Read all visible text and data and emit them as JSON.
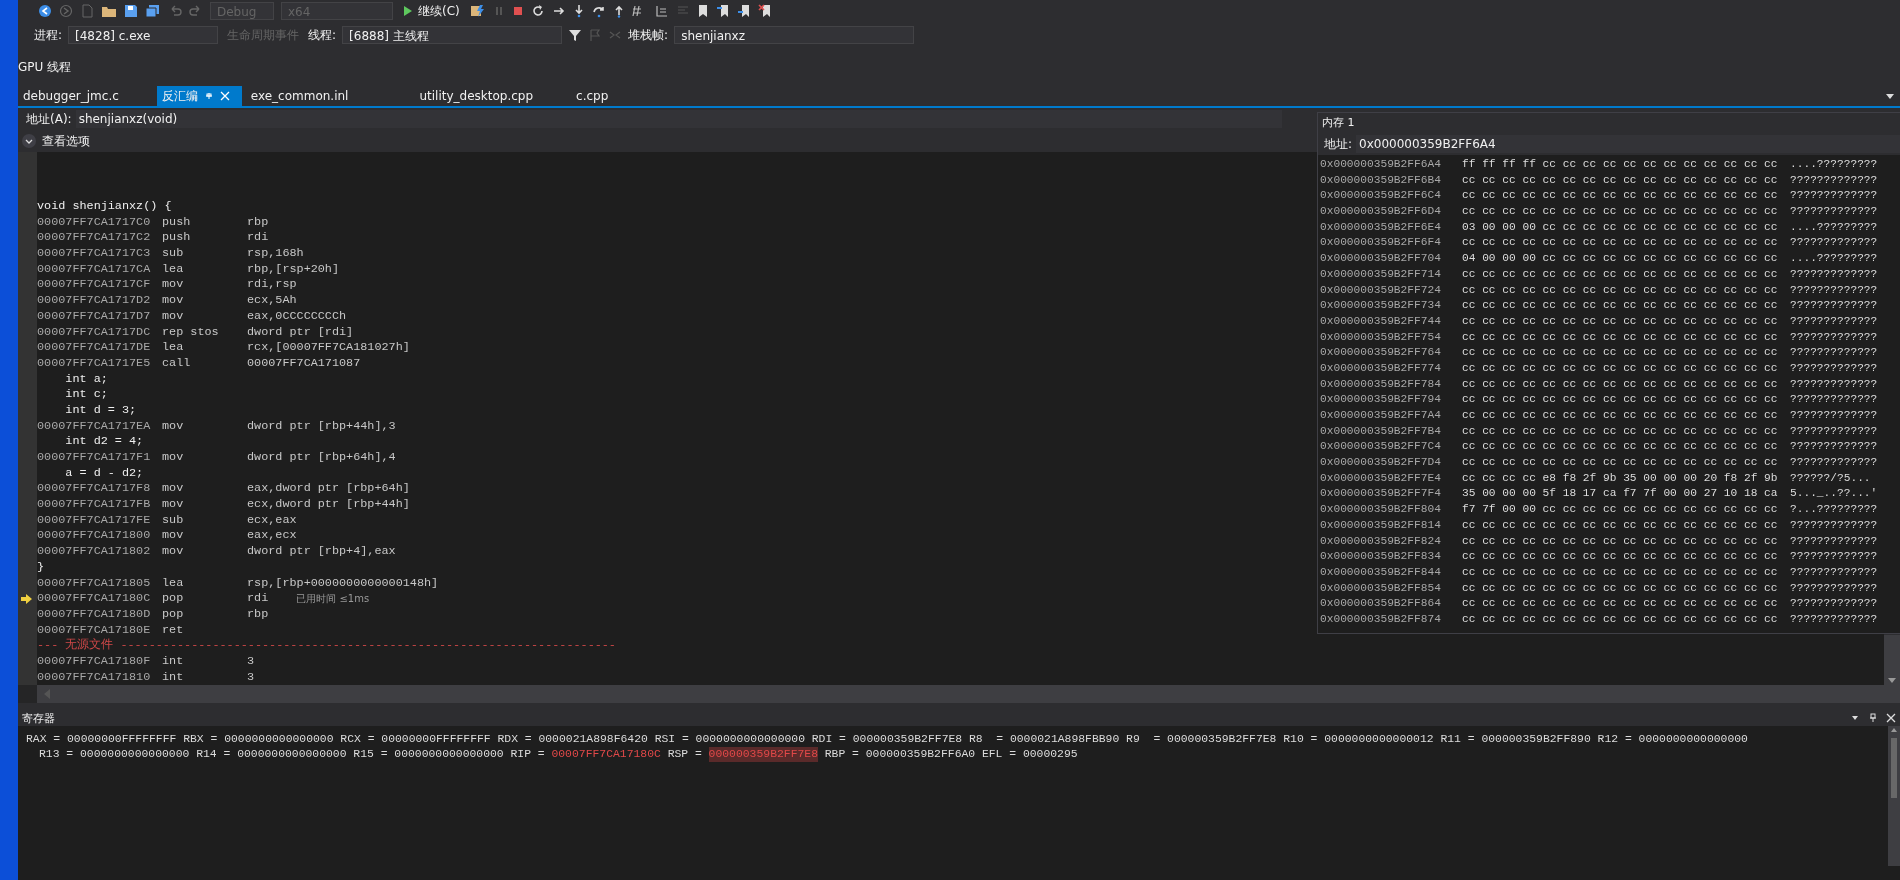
{
  "toolbar": {
    "configuration": "Debug",
    "platform": "x64",
    "continue_label": "继续(C)"
  },
  "debug_location": {
    "process_label": "进程:",
    "process": "[4828] c.exe",
    "lifecycle_events": {
      "label": "生命周期事件",
      "disabled": true
    },
    "thread_label": "线程:",
    "thread": "[6888] 主线程",
    "stack_frame_label": "堆栈帧:",
    "stack_frame": "shenjianxz"
  },
  "gpu_threads_label": "GPU 线程",
  "tabs": [
    {
      "label": "debugger_jmc.c",
      "selected": false
    },
    {
      "label": "反汇编",
      "selected": true
    },
    {
      "label": "exe_common.inl",
      "selected": false
    },
    {
      "label": "utility_desktop.cpp",
      "selected": false
    },
    {
      "label": "c.cpp",
      "selected": false
    }
  ],
  "disassembly": {
    "address_label": "地址(A):",
    "address": "shenjianxz(void)",
    "view_options": "查看选项",
    "lines": [
      {
        "kind": "source",
        "text": "void shenjianxz() {"
      },
      {
        "kind": "asm",
        "address": "00007FF7CA1717C0",
        "mnemonic": "push",
        "operands": "rbp",
        "current": false
      },
      {
        "kind": "asm",
        "address": "00007FF7CA1717C2",
        "mnemonic": "push",
        "operands": "rdi",
        "current": false
      },
      {
        "kind": "asm",
        "address": "00007FF7CA1717C3",
        "mnemonic": "sub",
        "operands": "rsp,168h",
        "current": false
      },
      {
        "kind": "asm",
        "address": "00007FF7CA1717CA",
        "mnemonic": "lea",
        "operands": "rbp,[rsp+20h]",
        "current": false
      },
      {
        "kind": "asm",
        "address": "00007FF7CA1717CF",
        "mnemonic": "mov",
        "operands": "rdi,rsp",
        "current": false
      },
      {
        "kind": "asm",
        "address": "00007FF7CA1717D2",
        "mnemonic": "mov",
        "operands": "ecx,5Ah",
        "current": false
      },
      {
        "kind": "asm",
        "address": "00007FF7CA1717D7",
        "mnemonic": "mov",
        "operands": "eax,0CCCCCCCCh",
        "current": false
      },
      {
        "kind": "asm",
        "address": "00007FF7CA1717DC",
        "mnemonic": "rep stos",
        "operands": "dword ptr [rdi]",
        "current": false
      },
      {
        "kind": "asm",
        "address": "00007FF7CA1717DE",
        "mnemonic": "lea",
        "operands": "rcx,[00007FF7CA181027h]",
        "current": false
      },
      {
        "kind": "asm",
        "address": "00007FF7CA1717E5",
        "mnemonic": "call",
        "operands": "00007FF7CA171087",
        "current": false
      },
      {
        "kind": "source",
        "text": "    int a;"
      },
      {
        "kind": "source",
        "text": "    int c;"
      },
      {
        "kind": "source",
        "text": "    int d = 3;"
      },
      {
        "kind": "asm",
        "address": "00007FF7CA1717EA",
        "mnemonic": "mov",
        "operands": "dword ptr [rbp+44h],3",
        "current": false
      },
      {
        "kind": "source",
        "text": "    int d2 = 4;"
      },
      {
        "kind": "asm",
        "address": "00007FF7CA1717F1",
        "mnemonic": "mov",
        "operands": "dword ptr [rbp+64h],4",
        "current": false
      },
      {
        "kind": "source",
        "text": "    a = d - d2;"
      },
      {
        "kind": "asm",
        "address": "00007FF7CA1717F8",
        "mnemonic": "mov",
        "operands": "eax,dword ptr [rbp+64h]",
        "current": false
      },
      {
        "kind": "asm",
        "address": "00007FF7CA1717FB",
        "mnemonic": "mov",
        "operands": "ecx,dword ptr [rbp+44h]",
        "current": false
      },
      {
        "kind": "asm",
        "address": "00007FF7CA1717FE",
        "mnemonic": "sub",
        "operands": "ecx,eax",
        "current": false
      },
      {
        "kind": "asm",
        "address": "00007FF7CA171800",
        "mnemonic": "mov",
        "operands": "eax,ecx",
        "current": false
      },
      {
        "kind": "asm",
        "address": "00007FF7CA171802",
        "mnemonic": "mov",
        "operands": "dword ptr [rbp+4],eax",
        "current": false
      },
      {
        "kind": "source",
        "text": "}"
      },
      {
        "kind": "asm",
        "address": "00007FF7CA171805",
        "mnemonic": "lea",
        "operands": "rsp,[rbp+0000000000000148h]",
        "current": false
      },
      {
        "kind": "asm",
        "address": "00007FF7CA17180C",
        "mnemonic": "pop",
        "operands": "rdi",
        "current": true,
        "hint": "已用时间 ≤1ms"
      },
      {
        "kind": "asm",
        "address": "00007FF7CA17180D",
        "mnemonic": "pop",
        "operands": "rbp",
        "current": false
      },
      {
        "kind": "asm",
        "address": "00007FF7CA17180E",
        "mnemonic": "ret",
        "current": false
      },
      {
        "kind": "separator",
        "text": "--- 无源文件 ----------------------------------------------------------------------"
      },
      {
        "kind": "asm",
        "address": "00007FF7CA17180F",
        "mnemonic": "int",
        "operands": "3",
        "current": false
      },
      {
        "kind": "asm",
        "address": "00007FF7CA171810",
        "mnemonic": "int",
        "operands": "3",
        "current": false
      }
    ]
  },
  "memory": {
    "title": "内存 1",
    "address_label": "地址:",
    "address": "0x000000359B2FF6A4",
    "rows": [
      {
        "address": "0x000000359B2FF6A4",
        "bytes": "ff ff ff ff cc cc cc cc cc cc cc cc cc cc cc cc",
        "ascii": "....?????????"
      },
      {
        "address": "0x000000359B2FF6B4",
        "bytes": "cc cc cc cc cc cc cc cc cc cc cc cc cc cc cc cc",
        "ascii": "?????????????"
      },
      {
        "address": "0x000000359B2FF6C4",
        "bytes": "cc cc cc cc cc cc cc cc cc cc cc cc cc cc cc cc",
        "ascii": "?????????????"
      },
      {
        "address": "0x000000359B2FF6D4",
        "bytes": "cc cc cc cc cc cc cc cc cc cc cc cc cc cc cc cc",
        "ascii": "?????????????"
      },
      {
        "address": "0x000000359B2FF6E4",
        "bytes": "03 00 00 00 cc cc cc cc cc cc cc cc cc cc cc cc",
        "ascii": "....?????????"
      },
      {
        "address": "0x000000359B2FF6F4",
        "bytes": "cc cc cc cc cc cc cc cc cc cc cc cc cc cc cc cc",
        "ascii": "?????????????"
      },
      {
        "address": "0x000000359B2FF704",
        "bytes": "04 00 00 00 cc cc cc cc cc cc cc cc cc cc cc cc",
        "ascii": "....?????????"
      },
      {
        "address": "0x000000359B2FF714",
        "bytes": "cc cc cc cc cc cc cc cc cc cc cc cc cc cc cc cc",
        "ascii": "?????????????"
      },
      {
        "address": "0x000000359B2FF724",
        "bytes": "cc cc cc cc cc cc cc cc cc cc cc cc cc cc cc cc",
        "ascii": "?????????????"
      },
      {
        "address": "0x000000359B2FF734",
        "bytes": "cc cc cc cc cc cc cc cc cc cc cc cc cc cc cc cc",
        "ascii": "?????????????"
      },
      {
        "address": "0x000000359B2FF744",
        "bytes": "cc cc cc cc cc cc cc cc cc cc cc cc cc cc cc cc",
        "ascii": "?????????????"
      },
      {
        "address": "0x000000359B2FF754",
        "bytes": "cc cc cc cc cc cc cc cc cc cc cc cc cc cc cc cc",
        "ascii": "?????????????"
      },
      {
        "address": "0x000000359B2FF764",
        "bytes": "cc cc cc cc cc cc cc cc cc cc cc cc cc cc cc cc",
        "ascii": "?????????????"
      },
      {
        "address": "0x000000359B2FF774",
        "bytes": "cc cc cc cc cc cc cc cc cc cc cc cc cc cc cc cc",
        "ascii": "?????????????"
      },
      {
        "address": "0x000000359B2FF784",
        "bytes": "cc cc cc cc cc cc cc cc cc cc cc cc cc cc cc cc",
        "ascii": "?????????????"
      },
      {
        "address": "0x000000359B2FF794",
        "bytes": "cc cc cc cc cc cc cc cc cc cc cc cc cc cc cc cc",
        "ascii": "?????????????"
      },
      {
        "address": "0x000000359B2FF7A4",
        "bytes": "cc cc cc cc cc cc cc cc cc cc cc cc cc cc cc cc",
        "ascii": "?????????????"
      },
      {
        "address": "0x000000359B2FF7B4",
        "bytes": "cc cc cc cc cc cc cc cc cc cc cc cc cc cc cc cc",
        "ascii": "?????????????"
      },
      {
        "address": "0x000000359B2FF7C4",
        "bytes": "cc cc cc cc cc cc cc cc cc cc cc cc cc cc cc cc",
        "ascii": "?????????????"
      },
      {
        "address": "0x000000359B2FF7D4",
        "bytes": "cc cc cc cc cc cc cc cc cc cc cc cc cc cc cc cc",
        "ascii": "?????????????"
      },
      {
        "address": "0x000000359B2FF7E4",
        "bytes": "cc cc cc cc e8 f8 2f 9b 35 00 00 00 20 f8 2f 9b",
        "ascii": "??????/?5..."
      },
      {
        "address": "0x000000359B2FF7F4",
        "bytes": "35 00 00 00 5f 18 17 ca f7 7f 00 00 27 10 18 ca",
        "ascii": "5..._..??...'"
      },
      {
        "address": "0x000000359B2FF804",
        "bytes": "f7 7f 00 00 cc cc cc cc cc cc cc cc cc cc cc cc",
        "ascii": "?...?????????"
      },
      {
        "address": "0x000000359B2FF814",
        "bytes": "cc cc cc cc cc cc cc cc cc cc cc cc cc cc cc cc",
        "ascii": "?????????????"
      },
      {
        "address": "0x000000359B2FF824",
        "bytes": "cc cc cc cc cc cc cc cc cc cc cc cc cc cc cc cc",
        "ascii": "?????????????"
      },
      {
        "address": "0x000000359B2FF834",
        "bytes": "cc cc cc cc cc cc cc cc cc cc cc cc cc cc cc cc",
        "ascii": "?????????????"
      },
      {
        "address": "0x000000359B2FF844",
        "bytes": "cc cc cc cc cc cc cc cc cc cc cc cc cc cc cc cc",
        "ascii": "?????????????"
      },
      {
        "address": "0x000000359B2FF854",
        "bytes": "cc cc cc cc cc cc cc cc cc cc cc cc cc cc cc cc",
        "ascii": "?????????????"
      },
      {
        "address": "0x000000359B2FF864",
        "bytes": "cc cc cc cc cc cc cc cc cc cc cc cc cc cc cc cc",
        "ascii": "?????????????"
      },
      {
        "address": "0x000000359B2FF874",
        "bytes": "cc cc cc cc cc cc cc cc cc cc cc cc cc cc cc cc",
        "ascii": "?????????????"
      }
    ]
  },
  "registers": {
    "title": "寄存器",
    "lines": [
      [
        {
          "name": "RAX =",
          "value": "00000000FFFFFFFF",
          "changed": false,
          "selected": false
        },
        {
          "name": "RBX =",
          "value": "0000000000000000",
          "changed": false,
          "selected": false
        },
        {
          "name": "RCX =",
          "value": "00000000FFFFFFFF",
          "changed": false,
          "selected": false
        },
        {
          "name": "RDX =",
          "value": "0000021A898F6420",
          "changed": false,
          "selected": false
        },
        {
          "name": "RSI =",
          "value": "0000000000000000",
          "changed": false,
          "selected": false
        },
        {
          "name": "RDI =",
          "value": "000000359B2FF7E8",
          "changed": false,
          "selected": false
        },
        {
          "name": "R8  =",
          "value": "0000021A898FBB90",
          "changed": false,
          "selected": false
        },
        {
          "name": "R9  =",
          "value": "000000359B2FF7E8",
          "changed": false,
          "selected": false
        },
        {
          "name": "R10 =",
          "value": "0000000000000012",
          "changed": false,
          "selected": false
        },
        {
          "name": "R11 =",
          "value": "000000359B2FF890",
          "changed": false,
          "selected": false
        },
        {
          "name": "R12 =",
          "value": "0000000000000000",
          "changed": false,
          "selected": false
        }
      ],
      [
        {
          "name": "R13 =",
          "value": "0000000000000000",
          "changed": false,
          "selected": false
        },
        {
          "name": "R14 =",
          "value": "0000000000000000",
          "changed": false,
          "selected": false
        },
        {
          "name": "R15 =",
          "value": "0000000000000000",
          "changed": false,
          "selected": false
        },
        {
          "name": "RIP =",
          "value": "00007FF7CA17180C",
          "changed": true,
          "selected": false
        },
        {
          "name": "RSP =",
          "value": "000000359B2FF7E8",
          "changed": true,
          "selected": true
        },
        {
          "name": "RBP =",
          "value": "000000359B2FF6A0",
          "changed": false,
          "selected": false
        },
        {
          "name": "EFL =",
          "value": "00000295",
          "changed": false,
          "selected": false
        }
      ]
    ]
  }
}
